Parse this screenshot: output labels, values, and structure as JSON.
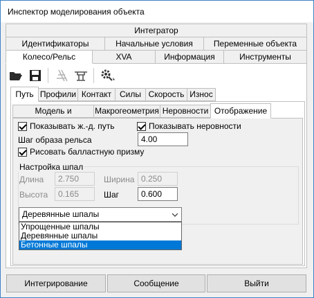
{
  "window": {
    "title": "Инспектор моделирования объекта"
  },
  "outer_tabs": {
    "row1": [
      "Интегратор"
    ],
    "row2": [
      "Идентификаторы",
      "Начальные условия",
      "Переменные объекта"
    ],
    "row3": [
      "Колесо/Рельс",
      "XVA",
      "Информация",
      "Инструменты"
    ],
    "active": "Колесо/Рельс"
  },
  "toolbar": {
    "icons": [
      "open-folder-icon",
      "save-icon",
      "rail-icon",
      "wheel-rail-icon",
      "settings-wand-icon"
    ]
  },
  "sub_tabs": {
    "items": [
      "Путь",
      "Профили",
      "Контакт",
      "Силы",
      "Скорость",
      "Износ"
    ],
    "active": "Путь"
  },
  "inner_tabs": {
    "items": [
      "Модель и параметры",
      "Макрогеометрия",
      "Неровности",
      "Отображение"
    ],
    "active": "Отображение"
  },
  "display": {
    "show_track": {
      "label": "Показывать ж.-д. путь",
      "checked": true
    },
    "show_irregularities": {
      "label": "Показывать неровности",
      "checked": true
    },
    "rail_step_label": "Шаг образа рельса",
    "rail_step_value": "4.00",
    "draw_ballast": {
      "label": "Рисовать балластную призму",
      "checked": true
    }
  },
  "sleepers": {
    "group_title": "Настройка шпал",
    "length_label": "Длина",
    "length_value": "2.750",
    "width_label": "Ширина",
    "width_value": "0.250",
    "height_label": "Высота",
    "height_value": "0.165",
    "step_label": "Шаг",
    "step_value": "0.600",
    "type_selected": "Деревянные шпалы",
    "type_options": [
      "Упрощенные шпалы",
      "Деревянные шпалы",
      "Бетонные шпалы"
    ],
    "highlighted_option": "Бетонные шпалы"
  },
  "buttons": {
    "integrate": "Интегрирование",
    "message": "Сообщение",
    "exit": "Выйти"
  },
  "colors": {
    "selection": "#0078d7",
    "window_border": "#3c82c8"
  }
}
